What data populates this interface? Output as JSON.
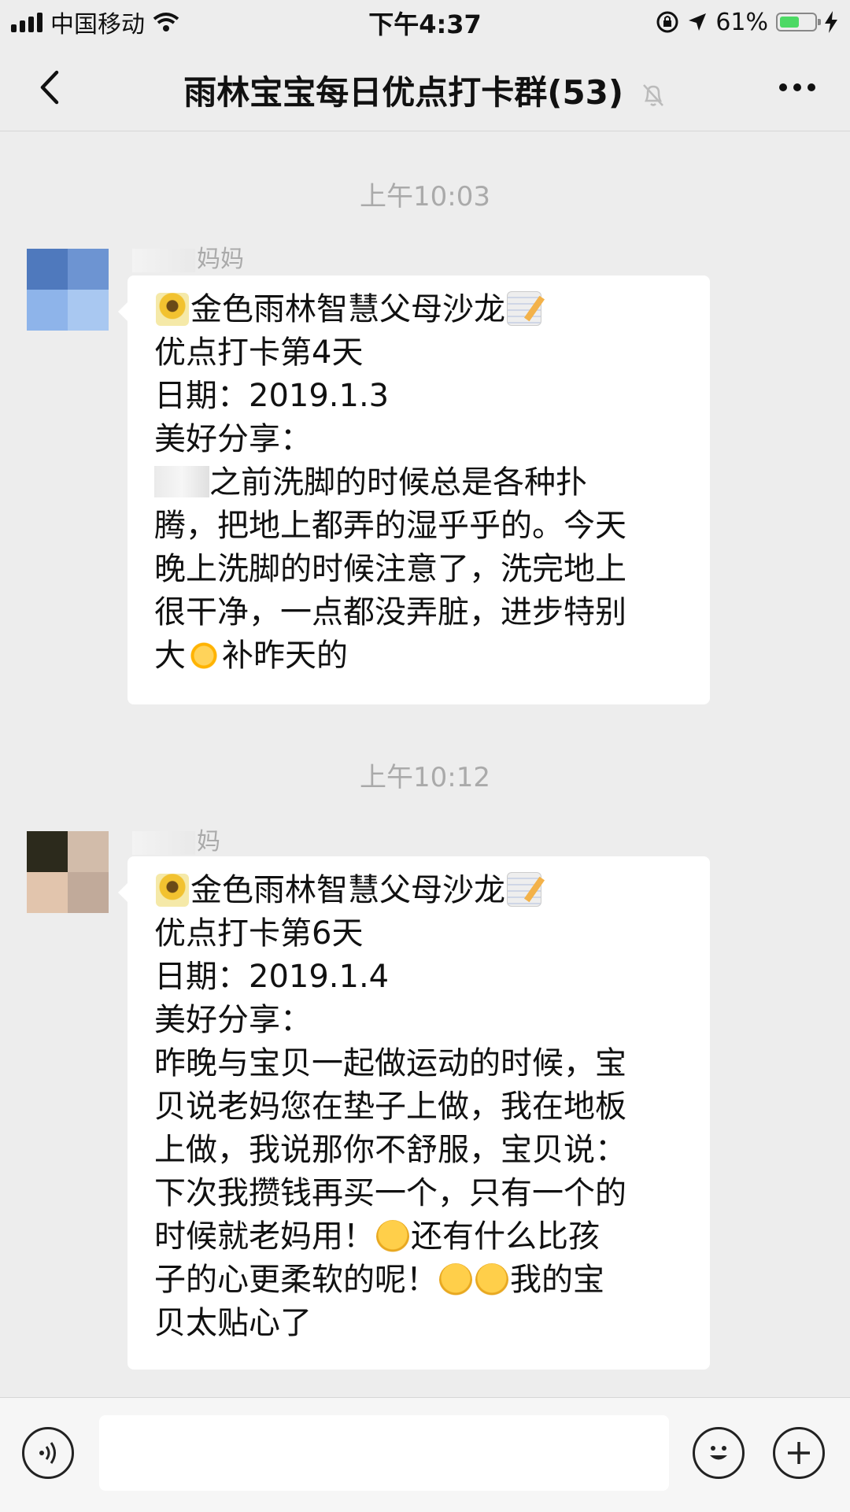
{
  "status_bar": {
    "carrier": "中国移动",
    "time": "下午4:37",
    "battery": "61%",
    "battery_level": 0.61
  },
  "nav": {
    "title": "雨林宝宝每日优点打卡群(53)"
  },
  "messages": [
    {
      "timestamp": "上午10:03",
      "sender": "妈妈",
      "lines": [
        "金色雨林智慧父母沙龙",
        "优点打卡第4天",
        "日期：2019.1.3",
        "美好分享：",
        "之前洗脚的时候总是各种扑",
        "腾，把地上都弄的湿乎乎的。今天",
        "晚上洗脚的时候注意了，洗完地上",
        "很干净，一点都没弄脏，进步特别",
        "大",
        "补昨天的"
      ]
    },
    {
      "timestamp": "上午10:12",
      "sender": "妈",
      "lines": [
        "金色雨林智慧父母沙龙",
        "优点打卡第6天",
        "日期：2019.1.4",
        "美好分享：",
        "昨晚与宝贝一起做运动的时候，宝",
        "贝说老妈您在垫子上做，我在地板",
        "上做，我说那你不舒服，宝贝说：",
        "下次我攒钱再买一个，只有一个的",
        "时候就老妈用！",
        "还有什么比孩",
        "子的心更柔软的呢！",
        "我的宝",
        "贝太贴心了"
      ]
    }
  ],
  "input_bar": {
    "placeholder": ""
  },
  "icons": {
    "back": "chevron-left-icon",
    "mute": "bell-mute-icon",
    "more": "more-dots-icon",
    "voice": "voice-icon",
    "emoji": "emoji-icon",
    "plus": "plus-icon"
  }
}
